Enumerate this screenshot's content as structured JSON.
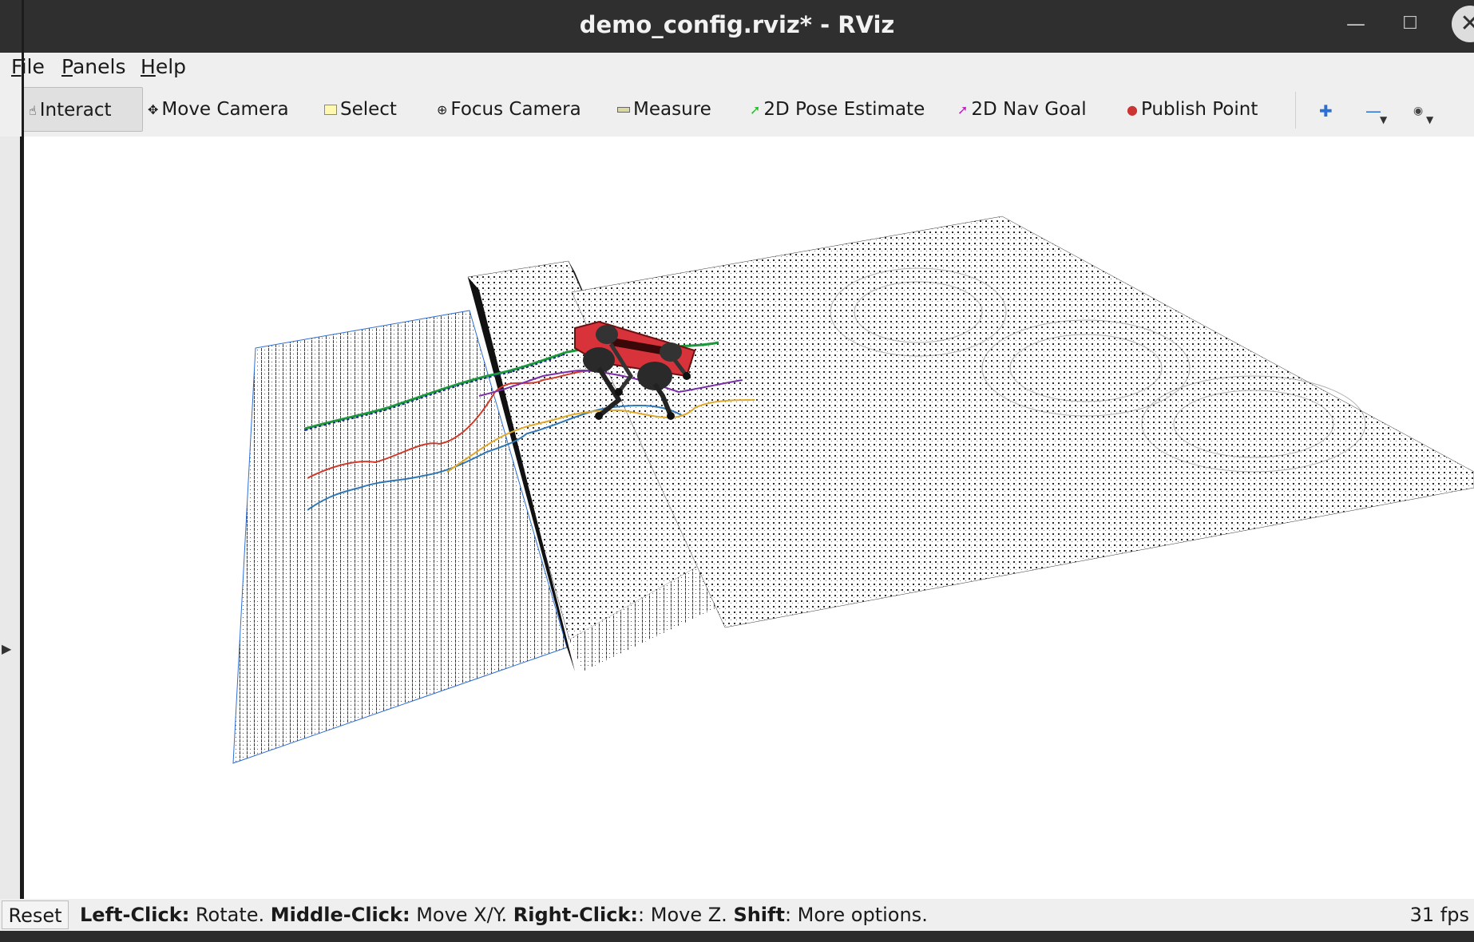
{
  "window": {
    "title": "demo_config.rviz* - RViz",
    "minimize_icon": "minimize-icon",
    "maximize_icon": "maximize-icon",
    "close_icon": "close-icon"
  },
  "menu": {
    "file": {
      "mnemonic": "F",
      "rest": "ile"
    },
    "panels": {
      "mnemonic": "P",
      "rest": "anels"
    },
    "help": {
      "mnemonic": "H",
      "rest": "elp"
    }
  },
  "toolbar": {
    "interact": {
      "label": "Interact",
      "icon": "cursor-icon",
      "active": true
    },
    "move_camera": {
      "label": "Move Camera",
      "icon": "move-arrows-icon"
    },
    "select": {
      "label": "Select",
      "icon": "select-box-icon"
    },
    "focus_camera": {
      "label": "Focus Camera",
      "icon": "crosshair-icon"
    },
    "measure": {
      "label": "Measure",
      "icon": "ruler-icon"
    },
    "pose_estimate": {
      "label": "2D Pose Estimate",
      "icon": "green-arrow-icon",
      "color": "#22c022"
    },
    "nav_goal": {
      "label": "2D Nav Goal",
      "icon": "magenta-arrow-icon",
      "color": "#c020c0"
    },
    "publish_point": {
      "label": "Publish Point",
      "icon": "map-pin-icon",
      "color": "#cc3333"
    },
    "zoom_in_icon": "plus-icon",
    "zoom_out_icon": "minus-icon",
    "view_icon": "eye-icon"
  },
  "viewport": {
    "description_icon": "3d-render-icon",
    "trajectory_colors": [
      "#d23b2a",
      "#2f78b8",
      "#e0a92b",
      "#7b2fa8",
      "#1a9a3a"
    ],
    "robot_color": "#d8333b"
  },
  "status": {
    "reset_label": "Reset",
    "hint_left_click": "Left-Click:",
    "hint_rotate": " Rotate. ",
    "hint_middle_click": "Middle-Click:",
    "hint_move_xy": " Move X/Y. ",
    "hint_right_click": "Right-Click:",
    "hint_move_z": ": Move Z. ",
    "hint_shift": "Shift",
    "hint_more": ": More options.",
    "fps": "31 fps"
  }
}
